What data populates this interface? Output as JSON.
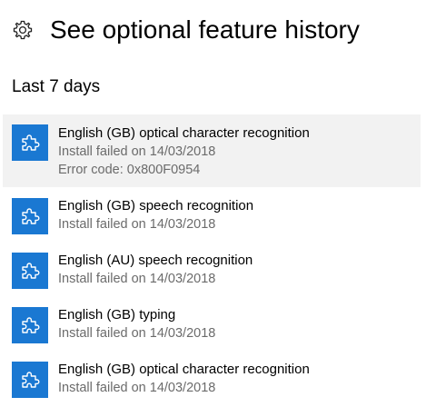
{
  "header": {
    "icon": "gear-icon",
    "title": "See optional feature history"
  },
  "section": {
    "label": "Last 7 days"
  },
  "items": [
    {
      "icon": "puzzle-piece-icon",
      "name": "English (GB) optical character recognition",
      "status": "Install failed on 14/03/2018",
      "error": "Error code: 0x800F0954",
      "selected": true
    },
    {
      "icon": "puzzle-piece-icon",
      "name": "English (GB) speech recognition",
      "status": "Install failed on 14/03/2018"
    },
    {
      "icon": "puzzle-piece-icon",
      "name": "English (AU) speech recognition",
      "status": "Install failed on 14/03/2018"
    },
    {
      "icon": "puzzle-piece-icon",
      "name": "English (GB) typing",
      "status": "Install failed on 14/03/2018"
    },
    {
      "icon": "puzzle-piece-icon",
      "name": "English (GB) optical character recognition",
      "status": "Install failed on 14/03/2018"
    }
  ],
  "colors": {
    "accent": "#1a78d2",
    "selected_background": "#f2f2f2",
    "secondary_text": "#6b6b6b"
  }
}
